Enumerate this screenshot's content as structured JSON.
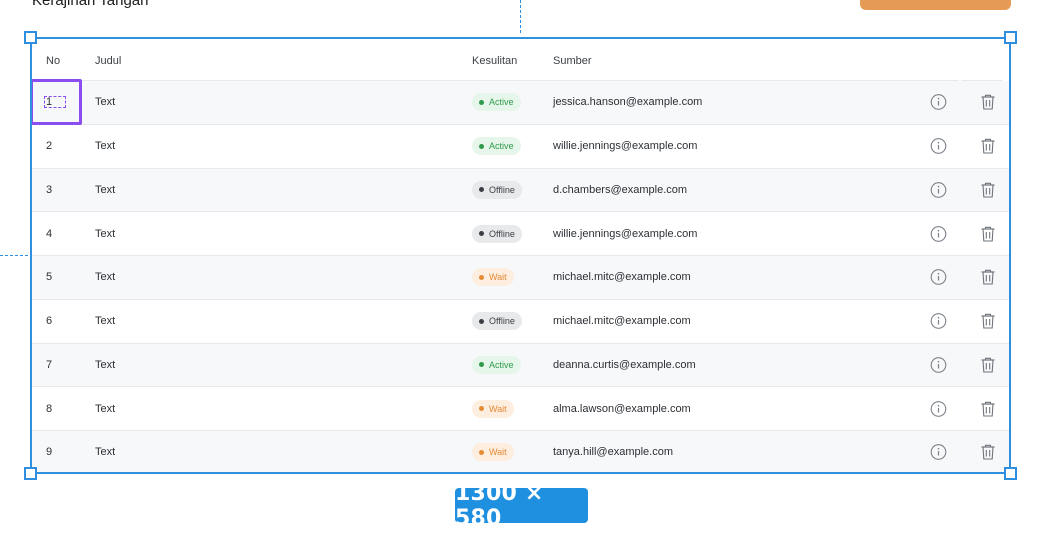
{
  "page": {
    "top_label": "Kerajinan Tangan"
  },
  "table": {
    "headers": [
      "No",
      "Judul",
      "Kesulitan",
      "Sumber"
    ],
    "rows": [
      {
        "no": "1",
        "judul": "Text",
        "status": "Active",
        "status_kind": "active",
        "email": "jessica.hanson@example.com"
      },
      {
        "no": "2",
        "judul": "Text",
        "status": "Active",
        "status_kind": "active",
        "email": "willie.jennings@example.com"
      },
      {
        "no": "3",
        "judul": "Text",
        "status": "Offline",
        "status_kind": "offline",
        "email": "d.chambers@example.com"
      },
      {
        "no": "4",
        "judul": "Text",
        "status": "Offline",
        "status_kind": "offline",
        "email": "willie.jennings@example.com"
      },
      {
        "no": "5",
        "judul": "Text",
        "status": "Wait",
        "status_kind": "wait",
        "email": "michael.mitc@example.com"
      },
      {
        "no": "6",
        "judul": "Text",
        "status": "Offline",
        "status_kind": "offline",
        "email": "michael.mitc@example.com"
      },
      {
        "no": "7",
        "judul": "Text",
        "status": "Active",
        "status_kind": "active",
        "email": "deanna.curtis@example.com"
      },
      {
        "no": "8",
        "judul": "Text",
        "status": "Wait",
        "status_kind": "wait",
        "email": "alma.lawson@example.com"
      },
      {
        "no": "9",
        "judul": "Text",
        "status": "Wait",
        "status_kind": "wait",
        "email": "tanya.hill@example.com"
      }
    ],
    "row_icons": [
      "info-icon",
      "trash-icon"
    ]
  },
  "selection": {
    "dimensions": "1300 × 580"
  },
  "colors": {
    "selection_blue": "#2f8fde",
    "highlight_purple": "#8a4df0",
    "orange_button": "#e59a55",
    "active_green": "#2f9a4c",
    "wait_orange": "#e58a36"
  }
}
